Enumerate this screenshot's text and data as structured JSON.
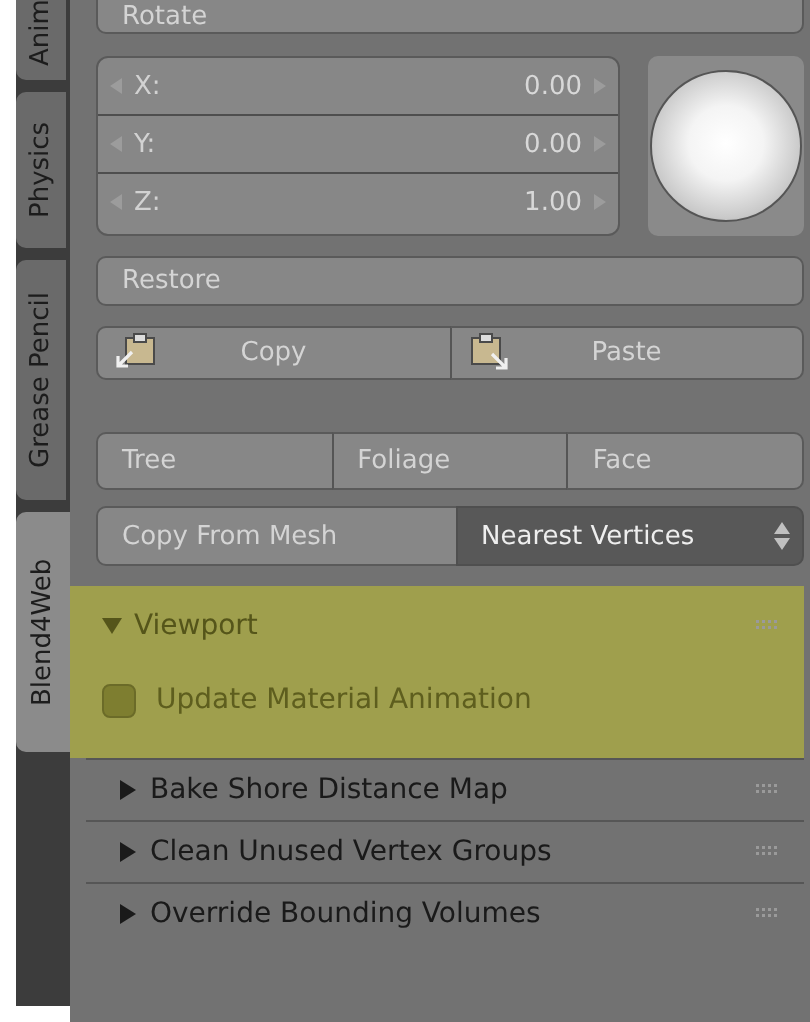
{
  "tabs": [
    {
      "label": "Anim",
      "selected": false
    },
    {
      "label": "Physics",
      "selected": false
    },
    {
      "label": "Grease Pencil",
      "selected": false
    },
    {
      "label": "Blend4Web",
      "selected": true
    }
  ],
  "rotate_button": "Rotate",
  "vector": [
    {
      "label": "X:",
      "value": "0.00"
    },
    {
      "label": "Y:",
      "value": "0.00"
    },
    {
      "label": "Z:",
      "value": "1.00"
    }
  ],
  "restore_button": "Restore",
  "clipboard_buttons": [
    {
      "label": "Copy",
      "kind": "copy"
    },
    {
      "label": "Paste",
      "kind": "paste"
    }
  ],
  "preset_buttons": [
    "Tree",
    "Foliage",
    "Face"
  ],
  "copy_from_mesh": {
    "button": "Copy From Mesh",
    "dropdown": "Nearest Vertices"
  },
  "panels": [
    {
      "title": "Viewport",
      "expanded": true,
      "highlighted": true,
      "checkbox": {
        "label": "Update Material Animation",
        "checked": false
      }
    },
    {
      "title": "Bake Shore Distance Map",
      "expanded": false,
      "highlighted": false
    },
    {
      "title": "Clean Unused Vertex Groups",
      "expanded": false,
      "highlighted": false
    },
    {
      "title": "Override Bounding Volumes",
      "expanded": false,
      "highlighted": false
    }
  ]
}
